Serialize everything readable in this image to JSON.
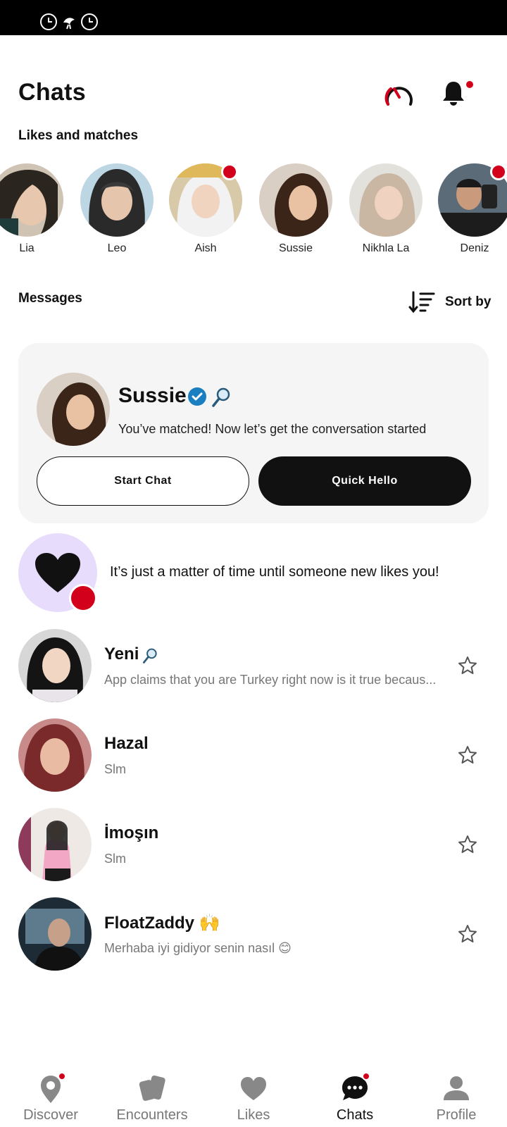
{
  "header": {
    "title": "Chats"
  },
  "likes": {
    "section_title": "Likes and matches",
    "items": [
      {
        "name": "Lia",
        "has_new": false
      },
      {
        "name": "Leo",
        "has_new": false
      },
      {
        "name": "Aish",
        "has_new": true
      },
      {
        "name": "Sussie",
        "has_new": false
      },
      {
        "name": "Nikhla La",
        "has_new": false
      },
      {
        "name": "Deniz",
        "has_new": true
      }
    ]
  },
  "messages": {
    "section_title": "Messages",
    "sort_label": "Sort by"
  },
  "match_card": {
    "name": "Sussie",
    "subtitle": "You’ve matched! Now let’s get the conversation started",
    "start_chat_label": "Start Chat",
    "quick_hello_label": "Quick Hello"
  },
  "promo": {
    "text": "It’s just a matter of time until someone new likes you!"
  },
  "chats": [
    {
      "name": "Yeni",
      "preview": "App claims that you are Turkey right now is it true becaus...",
      "badge": "magnifier-icon"
    },
    {
      "name": "Hazal",
      "preview": "Slm"
    },
    {
      "name": "İmoşın",
      "preview": "Slm"
    },
    {
      "name": "FloatZaddy 🙌",
      "preview": "Merhaba iyi gidiyor senin nasıl 😊"
    }
  ],
  "nav": {
    "items": [
      {
        "label": "Discover",
        "icon": "discover-pin-icon",
        "has_dot": true
      },
      {
        "label": "Encounters",
        "icon": "encounters-cards-icon",
        "has_dot": false
      },
      {
        "label": "Likes",
        "icon": "heart-icon",
        "has_dot": false
      },
      {
        "label": "Chats",
        "icon": "chat-bubble-icon",
        "has_dot": true,
        "active": true
      },
      {
        "label": "Profile",
        "icon": "profile-person-icon",
        "has_dot": false
      }
    ]
  },
  "colors": {
    "accent_red": "#d3001b",
    "verified_blue": "#1a7fc1",
    "promo_lavender": "#e7dcfb",
    "card_bg": "#f5f5f5"
  }
}
